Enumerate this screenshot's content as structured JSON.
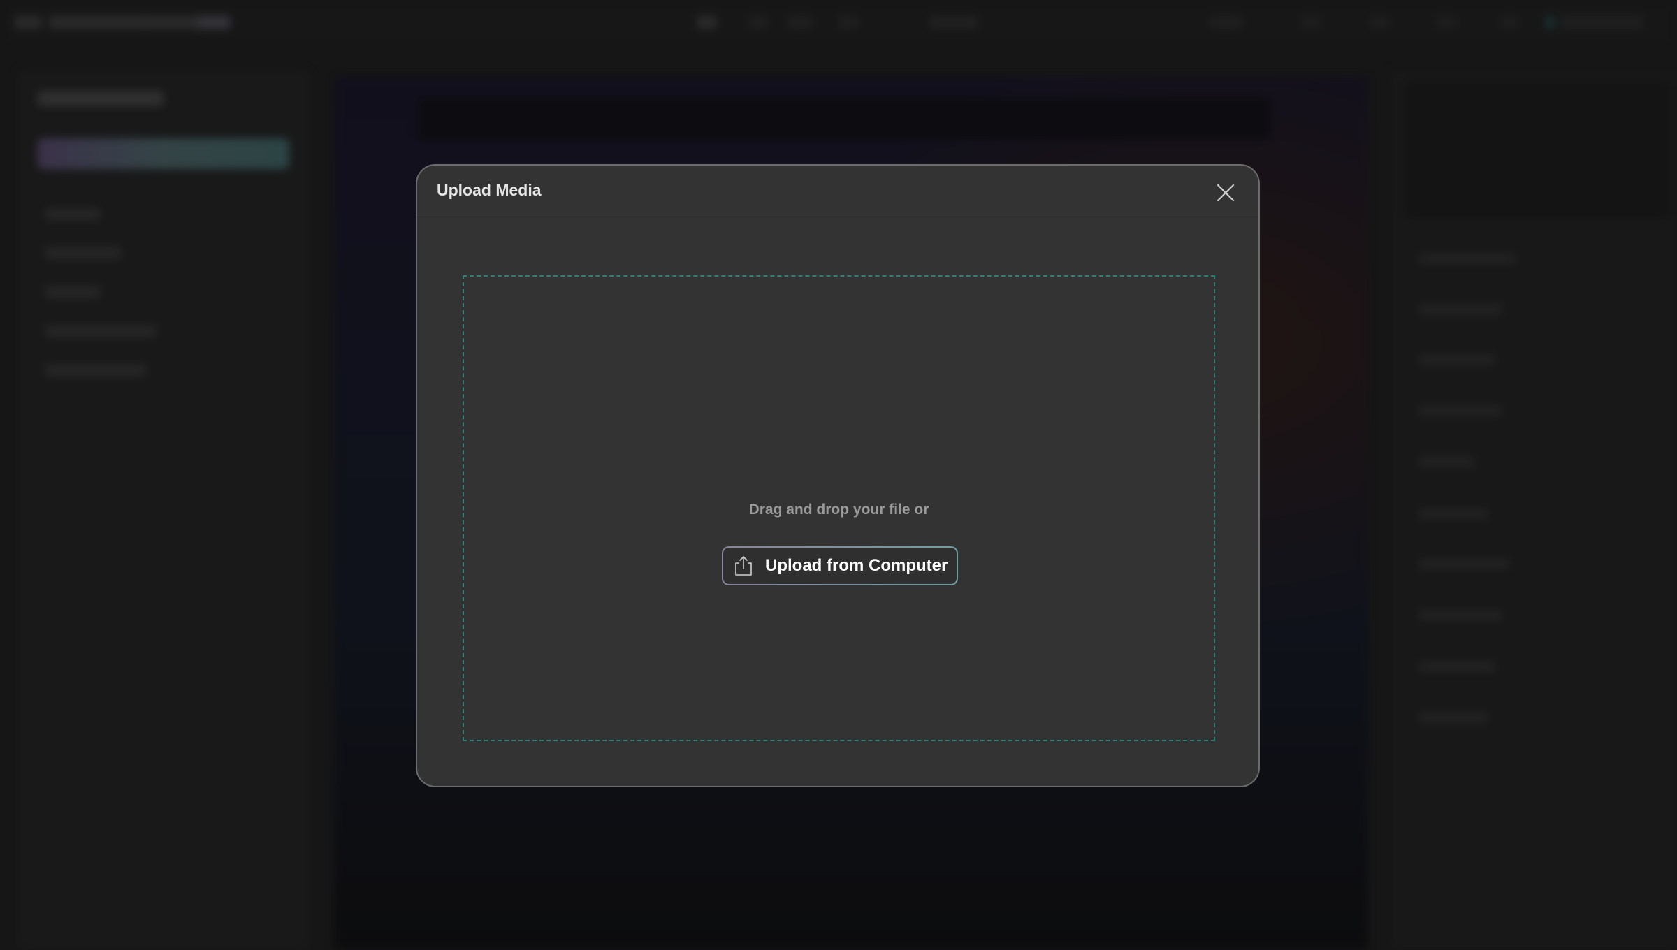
{
  "modal": {
    "title": "Upload Media",
    "close_icon": "close-icon",
    "dropzone": {
      "prompt": "Drag and drop your file or",
      "upload_button_label": "Upload from Computer",
      "upload_icon": "upload-icon"
    }
  },
  "colors": {
    "modal_background": "#333333",
    "dropzone_border": "#2f7f77",
    "button_border_start": "#8a849c",
    "button_border_end": "#6f9ea0",
    "title_text": "#e6e6e6",
    "prompt_text": "#9a9a9a"
  }
}
